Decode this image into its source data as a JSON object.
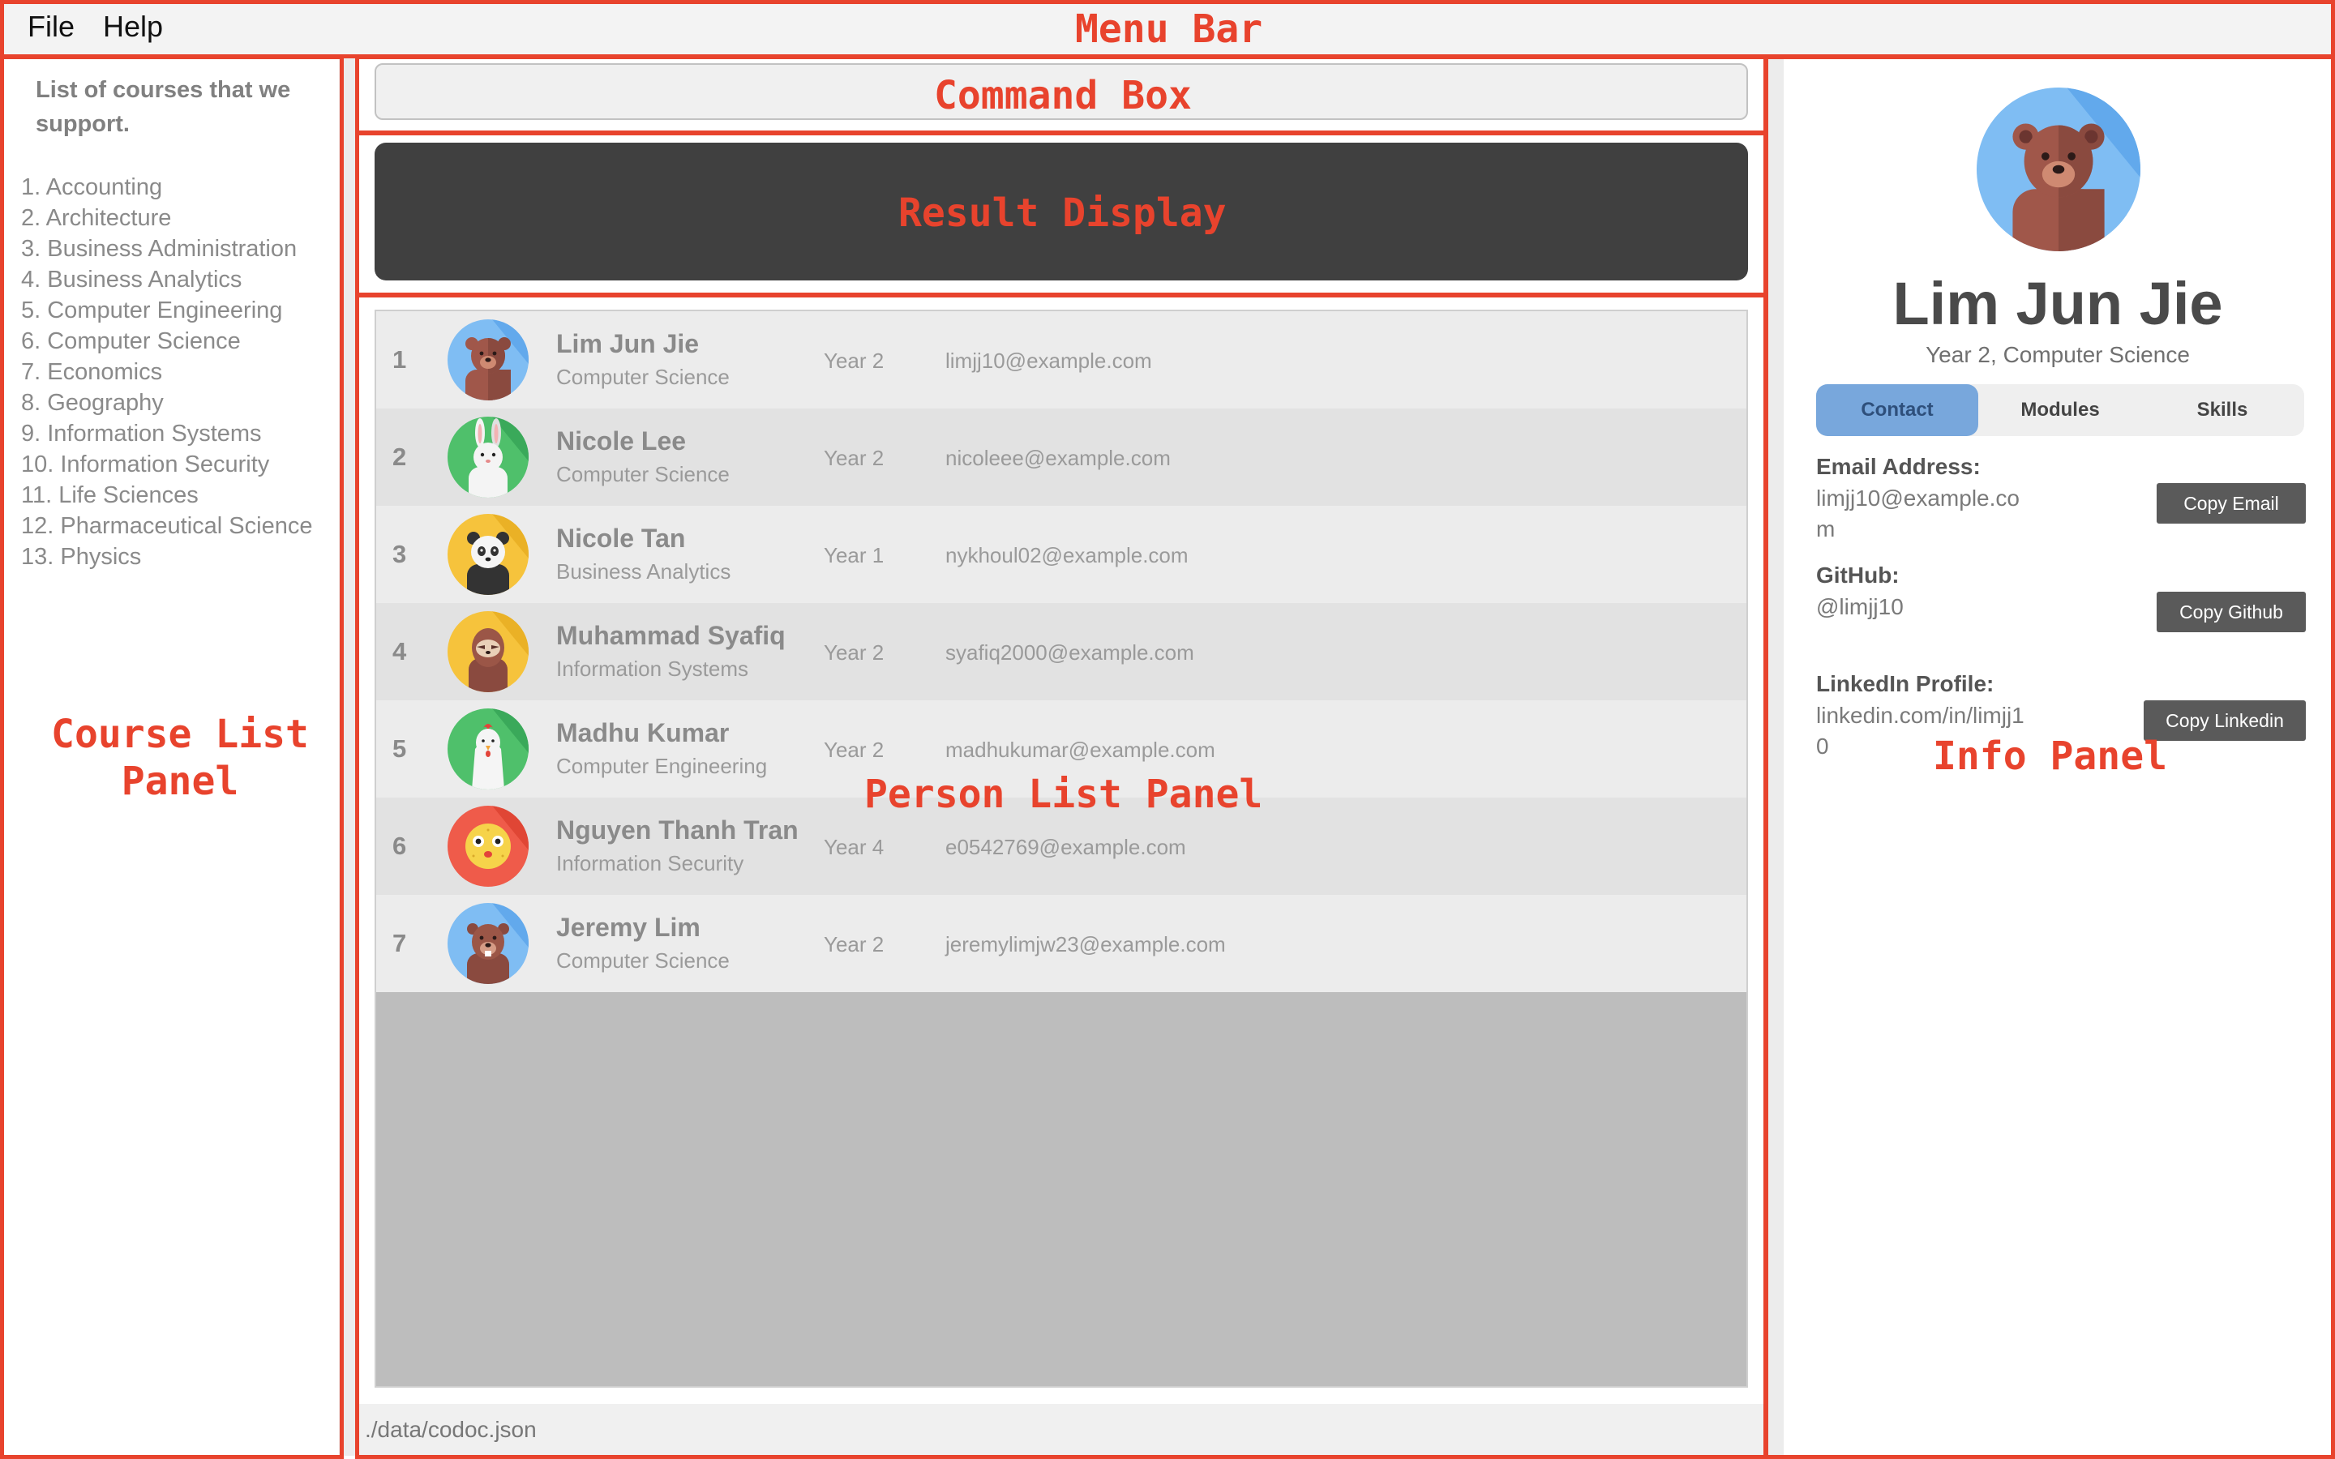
{
  "menu": {
    "file": "File",
    "help": "Help"
  },
  "course_panel": {
    "heading": "List of courses that we support.",
    "courses": [
      "1. Accounting",
      "2. Architecture",
      "3. Business Administration",
      "4. Business Analytics",
      "5. Computer Engineering",
      "6. Computer Science",
      "7. Economics",
      "8. Geography",
      "9. Information Systems",
      "10. Information Security",
      "11. Life Sciences",
      "12. Pharmaceutical Science",
      "13. Physics"
    ]
  },
  "command_box": {
    "value": ""
  },
  "result_display": {
    "text": ""
  },
  "persons": [
    {
      "index": "1",
      "name": "Lim Jun Jie",
      "course": "Computer Science",
      "year": "Year 2",
      "email": "limjj10@example.com",
      "avatar": "bear-icon"
    },
    {
      "index": "2",
      "name": "Nicole Lee",
      "course": "Computer Science",
      "year": "Year 2",
      "email": "nicoleee@example.com",
      "avatar": "rabbit-icon"
    },
    {
      "index": "3",
      "name": "Nicole Tan",
      "course": "Business Analytics",
      "year": "Year 1",
      "email": "nykhoul02@example.com",
      "avatar": "panda-icon"
    },
    {
      "index": "4",
      "name": "Muhammad Syafiq",
      "course": "Information Systems",
      "year": "Year 2",
      "email": "syafiq2000@example.com",
      "avatar": "sloth-icon"
    },
    {
      "index": "5",
      "name": "Madhu Kumar",
      "course": "Computer Engineering",
      "year": "Year 2",
      "email": "madhukumar@example.com",
      "avatar": "chicken-icon"
    },
    {
      "index": "6",
      "name": "Nguyen Thanh Tran",
      "course": "Information Security",
      "year": "Year 4",
      "email": "e0542769@example.com",
      "avatar": "pufferfish-icon"
    },
    {
      "index": "7",
      "name": "Jeremy Lim",
      "course": "Computer Science",
      "year": "Year 2",
      "email": "jeremylimjw23@example.com",
      "avatar": "beaver-icon"
    }
  ],
  "status_bar": {
    "path": "./data/codoc.json"
  },
  "info_panel": {
    "name": "Lim Jun Jie",
    "subtitle": "Year 2, Computer Science",
    "avatar": "bear-icon",
    "tabs": {
      "contact": "Contact",
      "modules": "Modules",
      "skills": "Skills",
      "active": "Contact"
    },
    "email_label": "Email Address:",
    "email_value": "limjj10@example.com",
    "github_label": "GitHub:",
    "github_value": "@limjj10",
    "linkedin_label": "LinkedIn Profile:",
    "linkedin_value": "linkedin.com/in/limjj10",
    "copy_email": "Copy Email",
    "copy_github": "Copy Github",
    "copy_linkedin": "Copy Linkedin"
  },
  "annotations": {
    "menu_bar": "Menu Bar",
    "command_box": "Command Box",
    "result_display": "Result Display",
    "course_list_line1": "Course List",
    "course_list_line2": "Panel",
    "person_list": "Person List Panel",
    "info_panel": "Info Panel"
  },
  "colors": {
    "annotation": "#e8432d",
    "result_bg": "#404040",
    "active_tab": "#78a7dc",
    "copy_button": "#5a5a5a"
  }
}
